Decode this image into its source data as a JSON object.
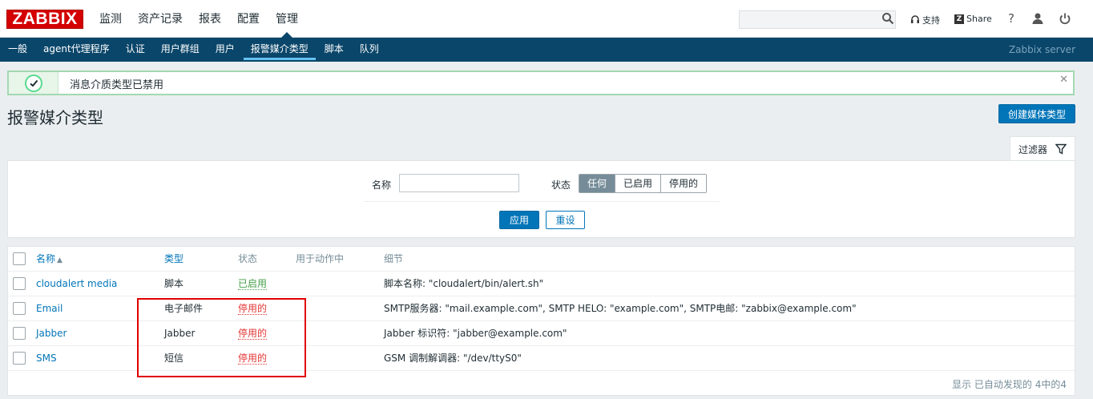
{
  "header": {
    "logo": "ZABBIX",
    "menu": [
      "监测",
      "资产记录",
      "报表",
      "配置",
      "管理"
    ],
    "active_menu": 4,
    "search_placeholder": "",
    "support": "支持",
    "share_icon_letter": "Z",
    "share": "Share"
  },
  "submenu": {
    "items": [
      "一般",
      "agent代理程序",
      "认证",
      "用户群组",
      "用户",
      "报警媒介类型",
      "脚本",
      "队列"
    ],
    "active": 5,
    "server": "Zabbix server"
  },
  "message": {
    "text": "消息介质类型已禁用"
  },
  "page": {
    "title": "报警媒介类型",
    "create_button": "创建媒体类型"
  },
  "filter": {
    "tab_label": "过滤器",
    "name_label": "名称",
    "name_value": "",
    "status_label": "状态",
    "status_options": [
      "任何",
      "已启用",
      "停用的"
    ],
    "status_selected": "任何",
    "apply": "应用",
    "reset": "重设"
  },
  "table": {
    "columns": [
      "名称",
      "类型",
      "状态",
      "用于动作中",
      "细节"
    ],
    "sort_indicator": "▲",
    "rows": [
      {
        "name": "cloudalert media",
        "type": "脚本",
        "status": "已启用",
        "used_in": "",
        "details": "脚本名称: \"cloudalert/bin/alert.sh\""
      },
      {
        "name": "Email",
        "type": "电子邮件",
        "status": "停用的",
        "used_in": "",
        "details": "SMTP服务器: \"mail.example.com\", SMTP HELO: \"example.com\", SMTP电邮: \"zabbix@example.com\""
      },
      {
        "name": "Jabber",
        "type": "Jabber",
        "status": "停用的",
        "used_in": "",
        "details": "Jabber 标识符: \"jabber@example.com\""
      },
      {
        "name": "SMS",
        "type": "短信",
        "status": "停用的",
        "used_in": "",
        "details": "GSM 调制解调器: \"/dev/ttyS0\""
      }
    ],
    "footer": "显示 已自动发现的 4中的4"
  },
  "colors": {
    "brand_red": "#d40000",
    "nav_blue": "#0a466a",
    "link_blue": "#0275b8",
    "enabled_green": "#429e47",
    "disabled_red": "#e33734"
  }
}
